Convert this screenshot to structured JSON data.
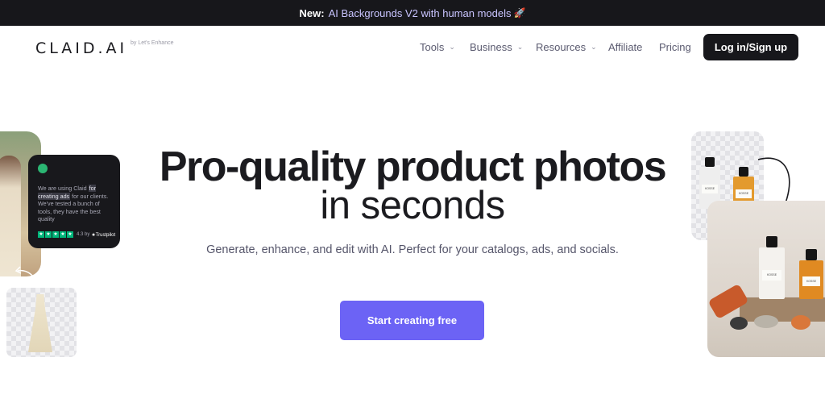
{
  "announcement": {
    "new_label": "New:",
    "message": "AI Backgrounds V2 with human models",
    "emoji": "🚀"
  },
  "nav": {
    "logo": "CLAID.AI",
    "logo_sub": "by Let's Enhance",
    "items": [
      {
        "label": "Tools",
        "has_dropdown": true
      },
      {
        "label": "Business",
        "has_dropdown": true
      },
      {
        "label": "Resources",
        "has_dropdown": true
      },
      {
        "label": "Affiliate",
        "has_dropdown": false
      },
      {
        "label": "Pricing",
        "has_dropdown": false
      }
    ],
    "login_label": "Log in/Sign up"
  },
  "hero": {
    "title": "Pro-quality product photos",
    "subtitle": "in seconds",
    "description": "Generate, enhance, and edit with AI. Perfect for your catalogs, ads, and socials.",
    "cta_label": "Start creating free"
  },
  "review": {
    "text_before": "We are using Claid ",
    "highlight": "for creating ads",
    "text_after": " for our clients. We've tested a bunch of tools, they have the best quality",
    "rating": "4.3 by",
    "source": "★Trustpilot"
  },
  "bottles": {
    "brand": "KOSSE"
  },
  "colors": {
    "announcement_bg": "#17171b",
    "cta_bg": "#6c63f5",
    "login_bg": "#17171b",
    "trustpilot_green": "#00b67a"
  }
}
